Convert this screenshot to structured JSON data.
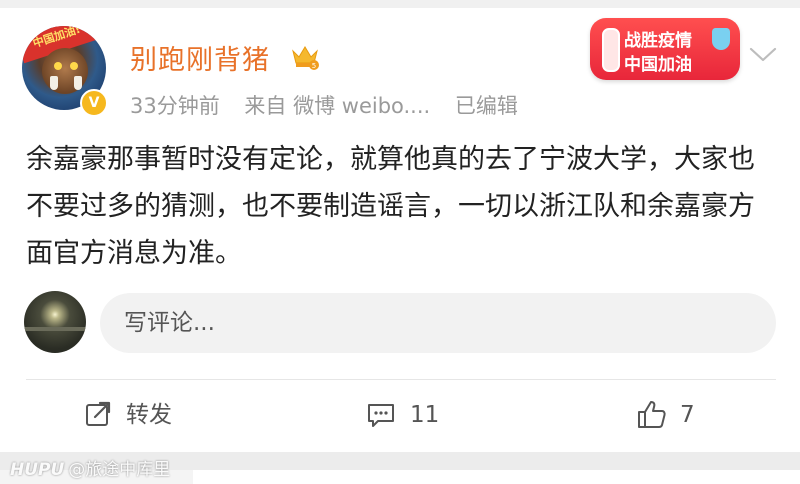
{
  "post": {
    "author": {
      "name": "别跑刚背猪",
      "avatar_banner": "中国加油!"
    },
    "meta": {
      "time": "33分钟前",
      "source": "来自 微博 weibo....",
      "edited": "已编辑"
    },
    "badge": {
      "line1": "战胜疫情",
      "line2": "中国加油"
    },
    "content": "余嘉豪那事暂时没有定论，就算他真的去了宁波大学，大家也不要过多的猜测，也不要制造谣言，一切以浙江队和余嘉豪方面官方消息为准。"
  },
  "comment_box": {
    "placeholder": "写评论..."
  },
  "actions": {
    "repost": "转发",
    "comments": "11",
    "likes": "7"
  },
  "watermark": {
    "brand": "HUPU",
    "user": "@旅途中库里"
  },
  "colors": {
    "username": "#e8722a",
    "badge_bg": "#e8263a",
    "text": "#222222",
    "meta": "#9a9a9a"
  },
  "icons": [
    "crown-icon",
    "verified-icon",
    "chevron-down-icon",
    "repost-icon",
    "comment-icon",
    "like-icon"
  ]
}
